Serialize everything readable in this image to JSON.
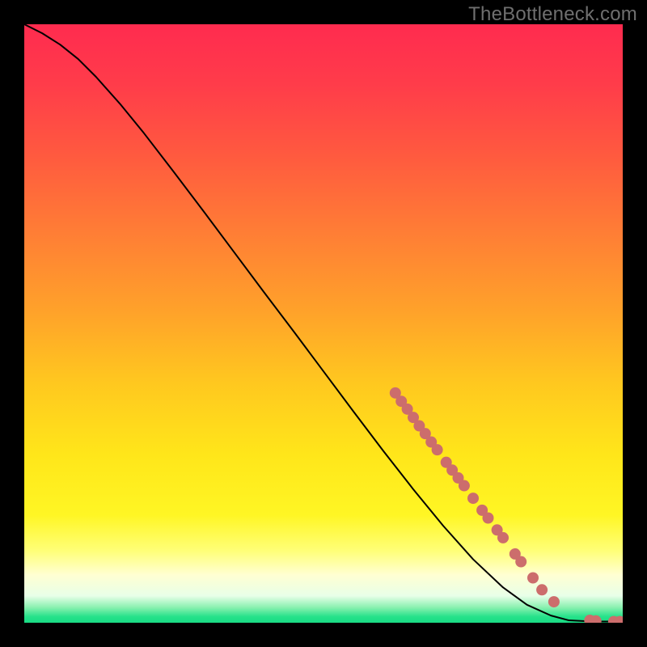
{
  "watermark": "TheBottleneck.com",
  "colors": {
    "point_fill": "#cc6d6c",
    "curve_stroke": "#000000",
    "bg_black": "#000000"
  },
  "gradient_stops": [
    {
      "offset": 0.0,
      "color": "#ff2b4f"
    },
    {
      "offset": 0.1,
      "color": "#ff3c4a"
    },
    {
      "offset": 0.22,
      "color": "#ff5a3f"
    },
    {
      "offset": 0.35,
      "color": "#ff7e35"
    },
    {
      "offset": 0.48,
      "color": "#ffa22a"
    },
    {
      "offset": 0.6,
      "color": "#ffc81f"
    },
    {
      "offset": 0.72,
      "color": "#ffe61a"
    },
    {
      "offset": 0.82,
      "color": "#fff624"
    },
    {
      "offset": 0.88,
      "color": "#ffff78"
    },
    {
      "offset": 0.92,
      "color": "#ffffd2"
    },
    {
      "offset": 0.955,
      "color": "#e8ffe8"
    },
    {
      "offset": 0.975,
      "color": "#86f0ae"
    },
    {
      "offset": 0.99,
      "color": "#25e28a"
    },
    {
      "offset": 1.0,
      "color": "#19db84"
    }
  ],
  "chart_data": {
    "type": "line",
    "title": "",
    "xlabel": "",
    "ylabel": "",
    "xlim": [
      0,
      100
    ],
    "ylim": [
      0,
      100
    ],
    "curve": [
      {
        "x": 0,
        "y": 100
      },
      {
        "x": 3,
        "y": 98.5
      },
      {
        "x": 6,
        "y": 96.6
      },
      {
        "x": 9,
        "y": 94.2
      },
      {
        "x": 12,
        "y": 91.2
      },
      {
        "x": 16,
        "y": 86.7
      },
      {
        "x": 20,
        "y": 81.8
      },
      {
        "x": 25,
        "y": 75.3
      },
      {
        "x": 30,
        "y": 68.7
      },
      {
        "x": 35,
        "y": 62.0
      },
      {
        "x": 40,
        "y": 55.3
      },
      {
        "x": 45,
        "y": 48.7
      },
      {
        "x": 50,
        "y": 42.0
      },
      {
        "x": 55,
        "y": 35.3
      },
      {
        "x": 60,
        "y": 28.7
      },
      {
        "x": 65,
        "y": 22.3
      },
      {
        "x": 70,
        "y": 16.2
      },
      {
        "x": 75,
        "y": 10.6
      },
      {
        "x": 80,
        "y": 5.9
      },
      {
        "x": 84,
        "y": 3.0
      },
      {
        "x": 88,
        "y": 1.2
      },
      {
        "x": 91,
        "y": 0.4
      },
      {
        "x": 95,
        "y": 0.2
      },
      {
        "x": 100,
        "y": 0.2
      }
    ],
    "highlighted_points": [
      {
        "x": 62.0,
        "y": 38.4
      },
      {
        "x": 63.0,
        "y": 37.0
      },
      {
        "x": 64.0,
        "y": 35.7
      },
      {
        "x": 65.0,
        "y": 34.3
      },
      {
        "x": 66.0,
        "y": 32.9
      },
      {
        "x": 67.0,
        "y": 31.6
      },
      {
        "x": 68.0,
        "y": 30.2
      },
      {
        "x": 69.0,
        "y": 28.9
      },
      {
        "x": 70.5,
        "y": 26.8
      },
      {
        "x": 71.5,
        "y": 25.5
      },
      {
        "x": 72.5,
        "y": 24.2
      },
      {
        "x": 73.5,
        "y": 22.9
      },
      {
        "x": 75.0,
        "y": 20.8
      },
      {
        "x": 76.5,
        "y": 18.8
      },
      {
        "x": 77.5,
        "y": 17.5
      },
      {
        "x": 79.0,
        "y": 15.5
      },
      {
        "x": 80.0,
        "y": 14.2
      },
      {
        "x": 82.0,
        "y": 11.5
      },
      {
        "x": 83.0,
        "y": 10.2
      },
      {
        "x": 85.0,
        "y": 7.5
      },
      {
        "x": 86.5,
        "y": 5.5
      },
      {
        "x": 88.5,
        "y": 3.5
      },
      {
        "x": 94.5,
        "y": 0.4
      },
      {
        "x": 95.5,
        "y": 0.3
      },
      {
        "x": 98.5,
        "y": 0.2
      },
      {
        "x": 99.5,
        "y": 0.2
      }
    ]
  }
}
